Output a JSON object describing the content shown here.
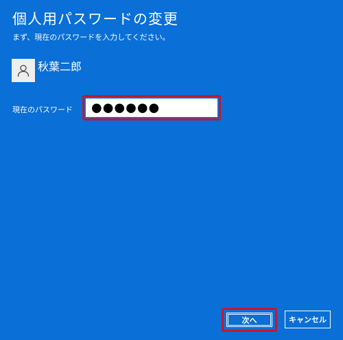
{
  "dialog": {
    "title": "個人用パスワードの変更",
    "subtitle": "まず、現在のパスワードを入力してください。"
  },
  "user": {
    "name": "秋葉二郎",
    "avatar_icon": "person-icon"
  },
  "password_field": {
    "label": "現在のパスワード",
    "value": "●●●●●●"
  },
  "buttons": {
    "next_label": "次へ",
    "cancel_label": "キャンセル"
  },
  "colors": {
    "background": "#0a6fd6",
    "highlight": "#c4182b"
  }
}
